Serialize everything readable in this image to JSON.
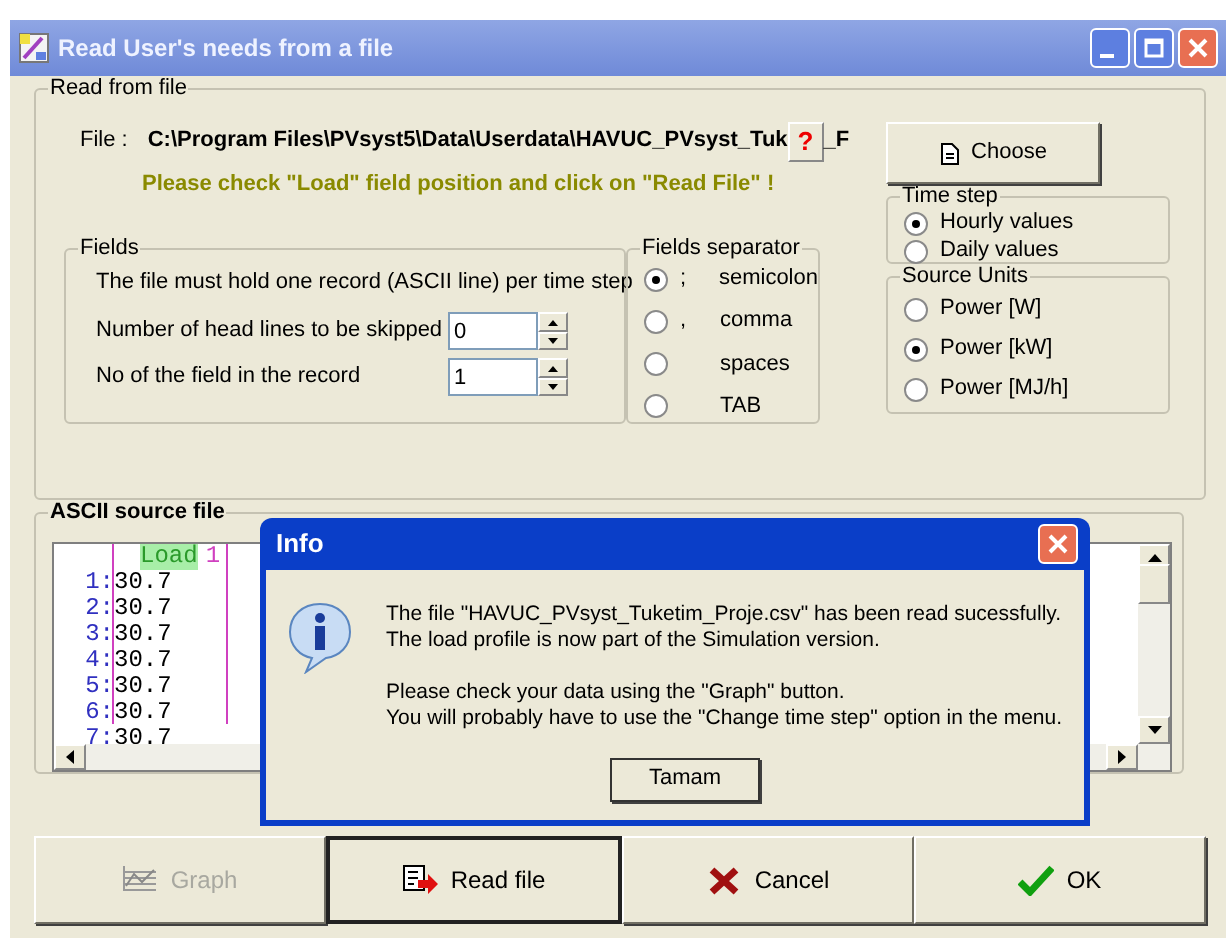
{
  "window": {
    "title": "Read User's needs from a file"
  },
  "read_from_file": {
    "label": "Read from file",
    "file_label": "File :",
    "file_path": "C:\\Program Files\\PVsyst5\\Data\\Userdata\\HAVUC_PVsyst_Tuk",
    "file_path_tail": "_F",
    "help_button": "?",
    "choose_button": "Choose",
    "hint": "Please check \"Load\" field position and click on  \"Read File\" !"
  },
  "fields": {
    "label": "Fields",
    "note": "The file must hold one record (ASCII line) per time step",
    "inputs": [
      {
        "label": "Number of head lines to be skipped",
        "value": "0"
      },
      {
        "label": "No of the field in the record",
        "value": "1"
      }
    ]
  },
  "separator": {
    "label": "Fields separator",
    "options": [
      {
        "symbol": ";",
        "label": "semicolon",
        "selected": true
      },
      {
        "symbol": ",",
        "label": "comma",
        "selected": false
      },
      {
        "label": "spaces",
        "selected": false
      },
      {
        "label": "TAB",
        "selected": false
      }
    ]
  },
  "time_step": {
    "label": "Time step",
    "options": [
      {
        "label": "Hourly values",
        "selected": true
      },
      {
        "label": "Daily values",
        "selected": false
      }
    ]
  },
  "source_units": {
    "label": "Source Units",
    "options": [
      {
        "label": "Power [W]",
        "selected": false
      },
      {
        "label": "Power [kW]",
        "selected": true
      },
      {
        "label": "Power [MJ/h]",
        "selected": false
      }
    ]
  },
  "ascii_source": {
    "label": "ASCII source file",
    "header_field": "Load",
    "header_index": "1",
    "lines": [
      {
        "number": "1:",
        "value": "30.7"
      },
      {
        "number": "2:",
        "value": "30.7"
      },
      {
        "number": "3:",
        "value": "30.7"
      },
      {
        "number": "4:",
        "value": "30.7"
      },
      {
        "number": "5:",
        "value": "30.7"
      },
      {
        "number": "6:",
        "value": "30.7"
      },
      {
        "number": "7:",
        "value": "30.7"
      }
    ]
  },
  "info_dialog": {
    "title": "Info",
    "paragraphs": [
      [
        "The file  \"HAVUC_PVsyst_Tuketim_Proje.csv\"  has been read sucessfully.",
        "The load profile is now part of the Simulation version."
      ],
      [
        "Please check your data using the \"Graph\"  button.",
        "You will probably have to use the \"Change time step\" option in the menu."
      ]
    ],
    "button": "Tamam"
  },
  "buttons": [
    {
      "kind": "graph",
      "label": "Graph",
      "disabled": true,
      "default": false
    },
    {
      "kind": "read",
      "label": "Read file",
      "disabled": false,
      "default": true
    },
    {
      "kind": "cancel",
      "label": "Cancel",
      "disabled": false,
      "default": false
    },
    {
      "kind": "ok",
      "label": "OK",
      "disabled": false,
      "default": false
    }
  ]
}
